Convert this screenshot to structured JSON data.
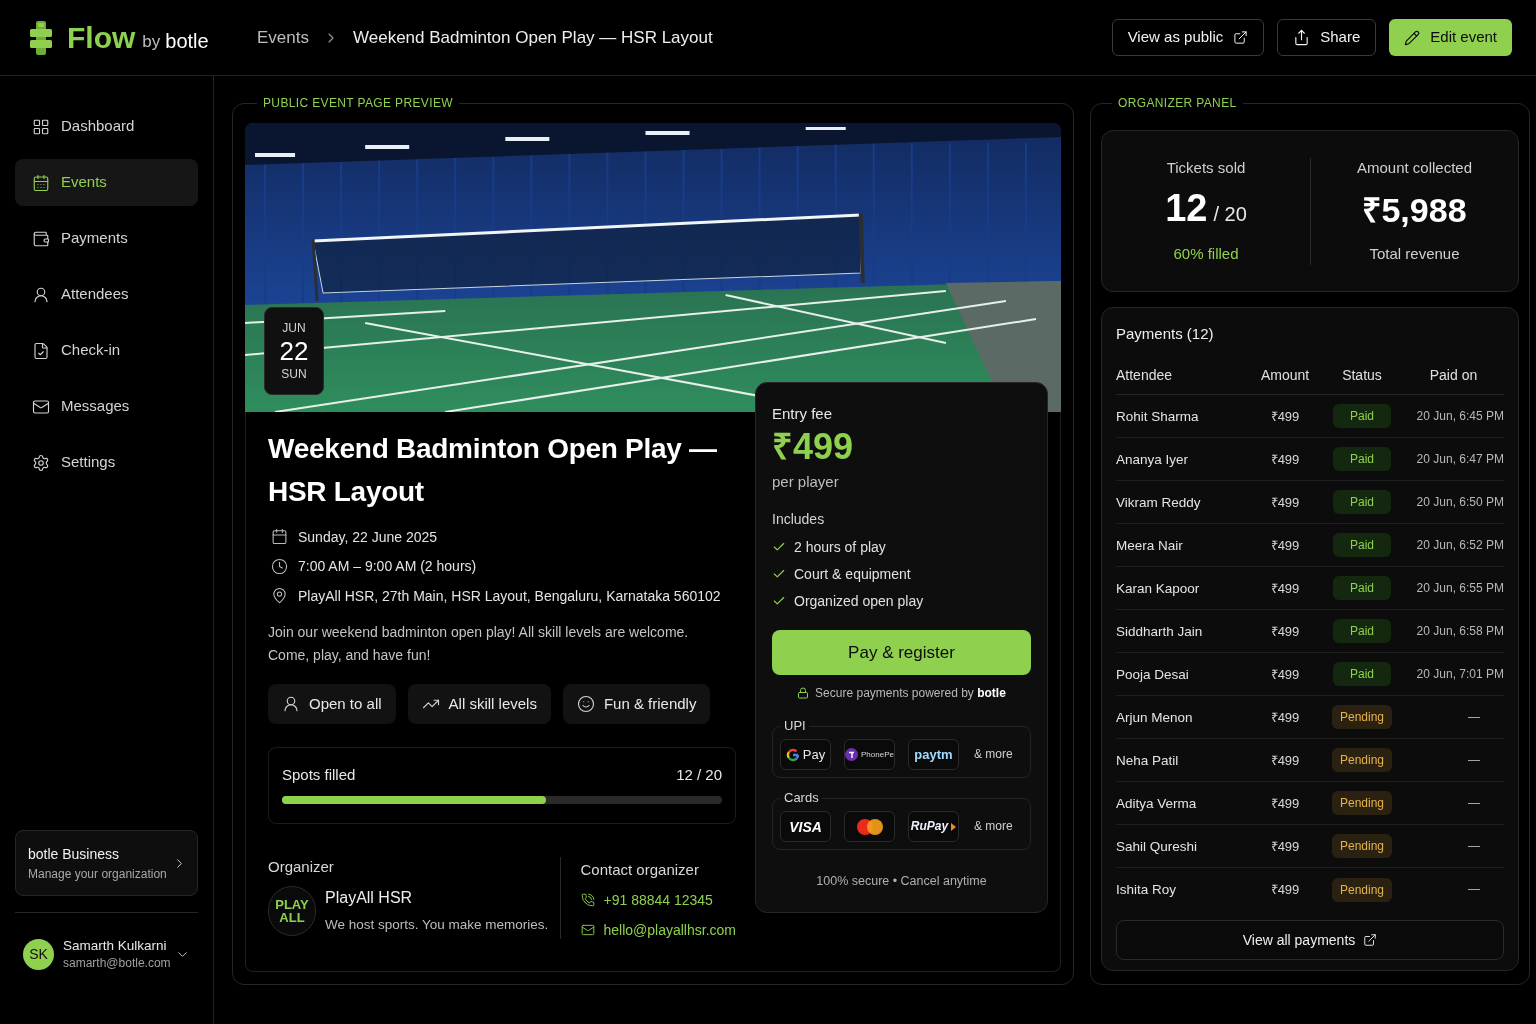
{
  "header": {
    "logo": {
      "name": "Flow",
      "by": "by",
      "brand": "botle"
    },
    "breadcrumb": [
      "Events",
      "Weekend Badminton Open Play — HSR Layout"
    ],
    "actions": [
      {
        "label": "View as public",
        "kind": "outline"
      },
      {
        "label": "Share",
        "kind": "outline"
      },
      {
        "label": "Edit event",
        "kind": "primary"
      }
    ]
  },
  "sidebar": {
    "items": [
      {
        "label": "Dashboard",
        "selected": false
      },
      {
        "label": "Events",
        "selected": true
      },
      {
        "label": "Payments",
        "selected": false
      },
      {
        "label": "Attendees",
        "selected": false
      },
      {
        "label": "Check-in",
        "selected": false
      },
      {
        "label": "Messages",
        "selected": false
      },
      {
        "label": "Settings",
        "selected": false
      }
    ],
    "business": {
      "title": "botle Business",
      "subtitle": "Manage your organization"
    },
    "user": {
      "initials": "SK",
      "name": "Samarth Kulkarni",
      "email": "samarth@botle.com"
    }
  },
  "preview": {
    "title": "PUBLIC EVENT PAGE PREVIEW",
    "date_badge": {
      "month": "JUN",
      "day": "22",
      "weekday": "SUN"
    },
    "event": {
      "title": "Weekend Badminton Open Play — HSR Layout",
      "details": [
        "Sunday, 22 June 2025",
        "7:00 AM – 9:00 AM (2 hours)",
        "PlayAll HSR, 27th Main, HSR Layout, Bengaluru, Karnataka 560102"
      ],
      "description": "Join our weekend badminton open play! All skill levels are welcome. Come, play, and have fun!",
      "tags": [
        "Open to all",
        "All skill levels",
        "Fun & friendly"
      ],
      "spots": {
        "label": "Spots filled",
        "count": "12 / 20",
        "level": 0.6
      },
      "organizer": {
        "heading": "Organizer",
        "logo_text": "PLAY ALL",
        "name": "PlayAll HSR",
        "tagline": "We host sports. You make memories."
      },
      "contact": {
        "heading": "Contact organizer",
        "phone": "+91 88844 12345",
        "email": "hello@playallhsr.com"
      }
    },
    "ticket": {
      "label": "Entry fee",
      "price": "₹499",
      "unit": "per player",
      "includes_label": "Includes",
      "includes": [
        "2 hours of play",
        "Court & equipment",
        "Organized open play"
      ],
      "button": "Pay & register",
      "secure_note": "Secure payments powered by **botle**",
      "upi": {
        "label": "UPI",
        "methods": [
          {
            "kind": "gpay",
            "label": "Pay"
          },
          {
            "kind": "phonepe",
            "label": "PhonePe"
          },
          {
            "kind": "paytm",
            "label": "paytm"
          }
        ],
        "more": "& more"
      },
      "cards": {
        "label": "Cards",
        "methods": [
          {
            "kind": "visa",
            "label": "VISA"
          },
          {
            "kind": "mastercard"
          },
          {
            "kind": "rupay",
            "label": "RuPay"
          }
        ],
        "more": "& more"
      },
      "footer": "100% secure • Cancel anytime"
    }
  },
  "organizer_panel": {
    "title": "ORGANIZER PANEL",
    "stats": [
      {
        "kind": "count",
        "label": "Tickets sold",
        "value": "12",
        "total": "/ 20",
        "note": "60% filled"
      },
      {
        "kind": "amount",
        "label": "Amount collected",
        "value": "₹5,988",
        "note": "Total revenue"
      }
    ],
    "payments": {
      "title": "Payments (12)",
      "columns": [
        "Attendee",
        "Amount",
        "Status",
        "Paid on"
      ],
      "rows": [
        {
          "attendee": "Rohit Sharma",
          "amount": "₹499",
          "status": {
            "kind": "paid",
            "label": "Paid"
          },
          "paid_on": "20 Jun, 6:45 PM"
        },
        {
          "attendee": "Ananya Iyer",
          "amount": "₹499",
          "status": {
            "kind": "paid",
            "label": "Paid"
          },
          "paid_on": "20 Jun, 6:47 PM"
        },
        {
          "attendee": "Vikram Reddy",
          "amount": "₹499",
          "status": {
            "kind": "paid",
            "label": "Paid"
          },
          "paid_on": "20 Jun, 6:50 PM"
        },
        {
          "attendee": "Meera Nair",
          "amount": "₹499",
          "status": {
            "kind": "paid",
            "label": "Paid"
          },
          "paid_on": "20 Jun, 6:52 PM"
        },
        {
          "attendee": "Karan Kapoor",
          "amount": "₹499",
          "status": {
            "kind": "paid",
            "label": "Paid"
          },
          "paid_on": "20 Jun, 6:55 PM"
        },
        {
          "attendee": "Siddharth Jain",
          "amount": "₹499",
          "status": {
            "kind": "paid",
            "label": "Paid"
          },
          "paid_on": "20 Jun, 6:58 PM"
        },
        {
          "attendee": "Pooja Desai",
          "amount": "₹499",
          "status": {
            "kind": "paid",
            "label": "Paid"
          },
          "paid_on": "20 Jun, 7:01 PM"
        },
        {
          "attendee": "Arjun Menon",
          "amount": "₹499",
          "status": {
            "kind": "pending",
            "label": "Pending"
          },
          "paid_on": "—"
        },
        {
          "attendee": "Neha Patil",
          "amount": "₹499",
          "status": {
            "kind": "pending",
            "label": "Pending"
          },
          "paid_on": "—"
        },
        {
          "attendee": "Aditya Verma",
          "amount": "₹499",
          "status": {
            "kind": "pending",
            "label": "Pending"
          },
          "paid_on": "—"
        },
        {
          "attendee": "Sahil Qureshi",
          "amount": "₹499",
          "status": {
            "kind": "pending",
            "label": "Pending"
          },
          "paid_on": "—"
        },
        {
          "attendee": "Ishita Roy",
          "amount": "₹499",
          "status": {
            "kind": "pending",
            "label": "Pending"
          },
          "paid_on": "—"
        }
      ],
      "button": "View all payments"
    }
  }
}
